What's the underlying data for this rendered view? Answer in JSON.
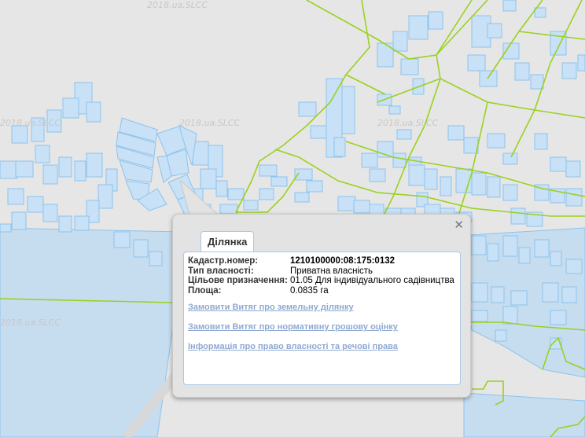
{
  "map": {
    "watermarks": [
      "2018.ua.SLCC",
      "2018.ua.SLCC",
      "2018.ua.SLCC",
      "2018.ua.SLCC",
      "2018.ua.SLCC"
    ],
    "colors": {
      "background": "#e6e6e6",
      "water": "#c6dcef",
      "parcel_fill": "#c8e1f6",
      "parcel_stroke": "#8ec3ec",
      "boundary": "#9ad11f"
    }
  },
  "popup": {
    "close_icon": "close-icon",
    "tab_label": "Ділянка",
    "fields": [
      {
        "label": "Кадастр.номер:",
        "value": "1210100000:08:175:0132"
      },
      {
        "label": "Тип власності:",
        "value": "Приватна власність"
      },
      {
        "label": "Цільове призначення:",
        "value": "01.05 Для індивідуального садівництва"
      },
      {
        "label": "Площа:",
        "value": "0.0835 га"
      }
    ],
    "links": [
      "Замовити Витяг про земельну ділянку",
      "Замовити Витяг про нормативну грошову оцінку",
      "Інформація про право власності та речові права"
    ]
  }
}
